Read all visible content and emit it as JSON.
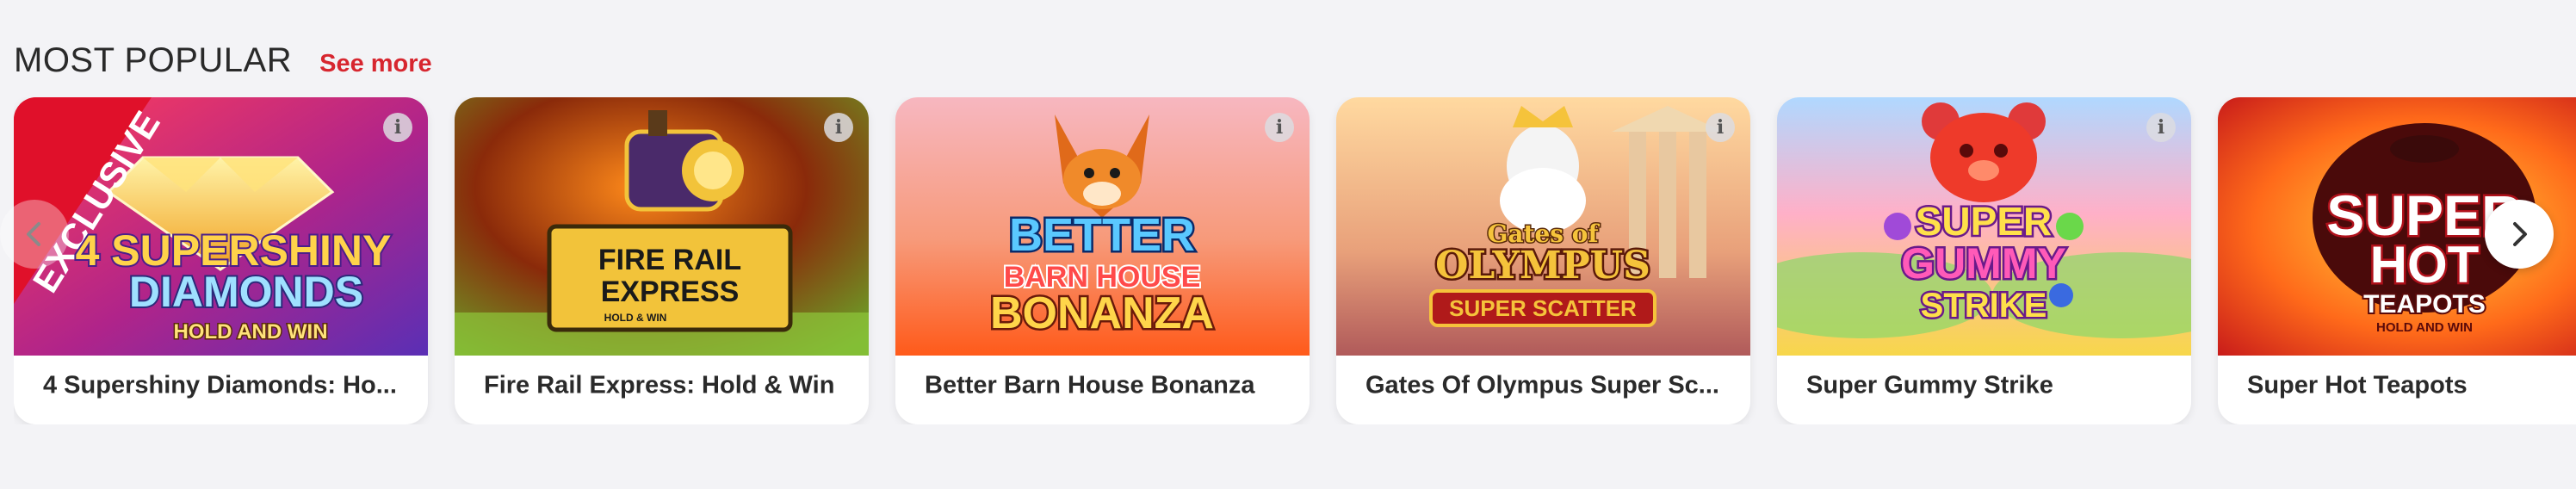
{
  "section": {
    "title": "MOST POPULAR",
    "see_more_label": "See more"
  },
  "games": [
    {
      "name": "4 Supershiny Diamonds: Ho...",
      "art_lines": [
        "4 SUPERSHINY",
        "DIAMONDS",
        "HOLD AND WIN"
      ],
      "ribbon": "EXCLUSIVE",
      "info_icon": "info-icon",
      "colors": {
        "bg_from": "#e2224a",
        "bg_to": "#7a2bb0",
        "accent": "#ffd34a"
      }
    },
    {
      "name": "Fire Rail Express: Hold & Win",
      "art_lines": [
        "FIRE RAIL",
        "EXPRESS",
        "HOLD & WIN"
      ],
      "info_icon": "info-icon",
      "colors": {
        "bg_from": "#3a1a08",
        "bg_to": "#7fb82a",
        "accent": "#f2c33a"
      }
    },
    {
      "name": "Better Barn House Bonanza",
      "art_lines": [
        "BETTER",
        "BARN HOUSE",
        "BONANZA"
      ],
      "info_icon": "info-icon",
      "colors": {
        "bg_from": "#f4a0a8",
        "bg_to": "#ff6a2a",
        "accent": "#ffd54a"
      }
    },
    {
      "name": "Gates Of Olympus Super Sc...",
      "art_lines": [
        "Gates of",
        "OLYMPUS",
        "SUPER SCATTER"
      ],
      "info_icon": "info-icon",
      "colors": {
        "bg_from": "#f7c08a",
        "bg_to": "#c2706a",
        "accent": "#f5c33b"
      }
    },
    {
      "name": "Super Gummy Strike",
      "art_lines": [
        "SUPER",
        "GUMMY",
        "STRIKE"
      ],
      "info_icon": "info-icon",
      "colors": {
        "bg_from": "#8ec8ff",
        "bg_to": "#f7d74a",
        "accent": "#e03a3a"
      }
    },
    {
      "name": "Super Hot Teapots",
      "art_lines": [
        "SUPER",
        "HOT",
        "TEAPOTS",
        "HOLD AND WIN"
      ],
      "info_icon": "info-icon",
      "colors": {
        "bg_from": "#ffd43a",
        "bg_to": "#d0101a",
        "accent": "#ffffff"
      }
    }
  ],
  "controls": {
    "prev_icon": "chevron-left-icon",
    "next_icon": "chevron-right-icon"
  }
}
